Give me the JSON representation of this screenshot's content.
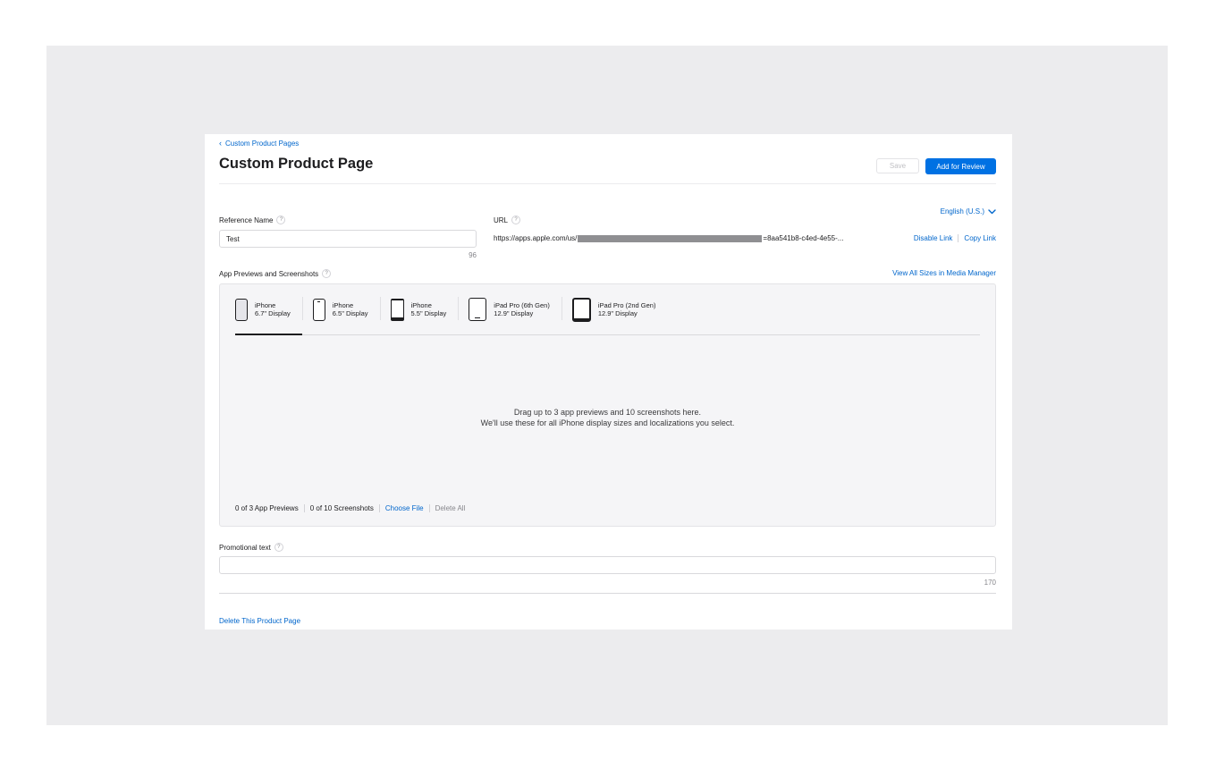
{
  "breadcrumb": {
    "label": "Custom Product Pages"
  },
  "header": {
    "title": "Custom Product Page",
    "save_label": "Save",
    "review_label": "Add for Review"
  },
  "language": {
    "selected": "English (U.S.)"
  },
  "reference_name": {
    "label": "Reference Name",
    "value": "Test",
    "counter": "96"
  },
  "url": {
    "label": "URL",
    "prefix": "https://apps.apple.com/us/",
    "suffix": "=8aa541b8-c4ed-4e55-...",
    "disable_link": "Disable Link",
    "copy_link": "Copy Link"
  },
  "media": {
    "section_label": "App Previews and Screenshots",
    "view_all_link": "View All Sizes in Media Manager",
    "tabs": [
      {
        "name": "iPhone",
        "size": "6.7\" Display",
        "icon": "iphone-67-icon"
      },
      {
        "name": "iPhone",
        "size": "6.5\" Display",
        "icon": "iphone-65-icon"
      },
      {
        "name": "iPhone",
        "size": "5.5\" Display",
        "icon": "iphone-55-icon"
      },
      {
        "name": "iPad Pro (6th Gen)",
        "size": "12.9\" Display",
        "icon": "ipad-pro-6th-icon"
      },
      {
        "name": "iPad Pro (2nd Gen)",
        "size": "12.9\" Display",
        "icon": "ipad-pro-2nd-icon"
      }
    ],
    "drop_line1": "Drag up to 3 app previews and 10 screenshots here.",
    "drop_line2": "We'll use these for all iPhone display sizes and localizations you select.",
    "previews_count": "0 of 3 App Previews",
    "screenshots_count": "0 of 10 Screenshots",
    "choose_file": "Choose File",
    "delete_all": "Delete All"
  },
  "promotional_text": {
    "label": "Promotional text",
    "value": "",
    "counter": "170"
  },
  "footer": {
    "delete_page": "Delete This Product Page"
  },
  "colors": {
    "accent": "#0071e3",
    "link": "#0066cc",
    "backdrop": "#ececee"
  }
}
